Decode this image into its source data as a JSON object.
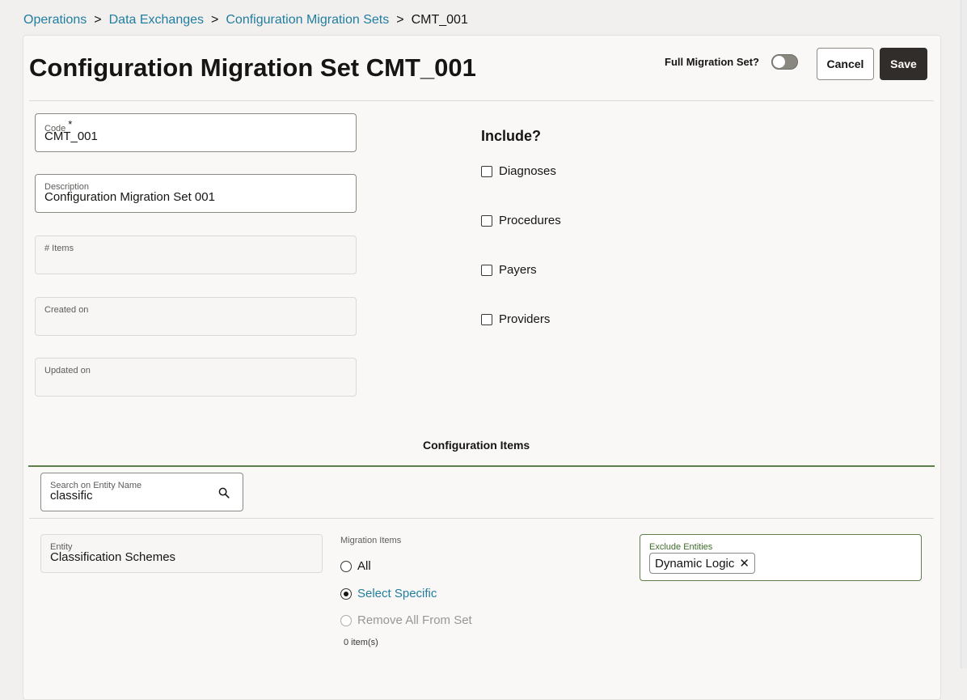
{
  "breadcrumb": {
    "items": [
      "Operations",
      "Data Exchanges",
      "Configuration Migration Sets"
    ],
    "separator": ">",
    "current": "CMT_001"
  },
  "header": {
    "title": "Configuration Migration Set CMT_001",
    "full_migration_label": "Full Migration Set?",
    "full_migration_on": false,
    "cancel_label": "Cancel",
    "save_label": "Save"
  },
  "form": {
    "code": {
      "label": "Code",
      "required_marker": "*",
      "value": "CMT_001"
    },
    "description": {
      "label": "Description",
      "value": "Configuration Migration Set 001"
    },
    "items": {
      "label": "# Items",
      "value": ""
    },
    "created_on": {
      "label": "Created on",
      "value": ""
    },
    "updated_on": {
      "label": "Updated on",
      "value": ""
    }
  },
  "include": {
    "title": "Include?",
    "options": [
      {
        "label": "Diagnoses",
        "checked": false
      },
      {
        "label": "Procedures",
        "checked": false
      },
      {
        "label": "Payers",
        "checked": false
      },
      {
        "label": "Providers",
        "checked": false
      }
    ]
  },
  "config_items": {
    "title": "Configuration Items",
    "search": {
      "label": "Search on Entity Name",
      "value": "classific",
      "icon": "search-icon"
    },
    "entity": {
      "label": "Entity",
      "value": "Classification Schemes"
    },
    "migration_items": {
      "label": "Migration Items",
      "options": [
        {
          "label": "All",
          "selected": false,
          "disabled": false
        },
        {
          "label": "Select Specific",
          "selected": true,
          "disabled": false
        },
        {
          "label": "Remove All From Set",
          "selected": false,
          "disabled": true
        }
      ],
      "count_text": "0 item(s)"
    },
    "exclude": {
      "label": "Exclude Entities",
      "chips": [
        "Dynamic Logic"
      ]
    }
  },
  "colors": {
    "link": "#227e9e",
    "primary_button": "#312d2a",
    "section_rule": "#5f7f4a"
  }
}
